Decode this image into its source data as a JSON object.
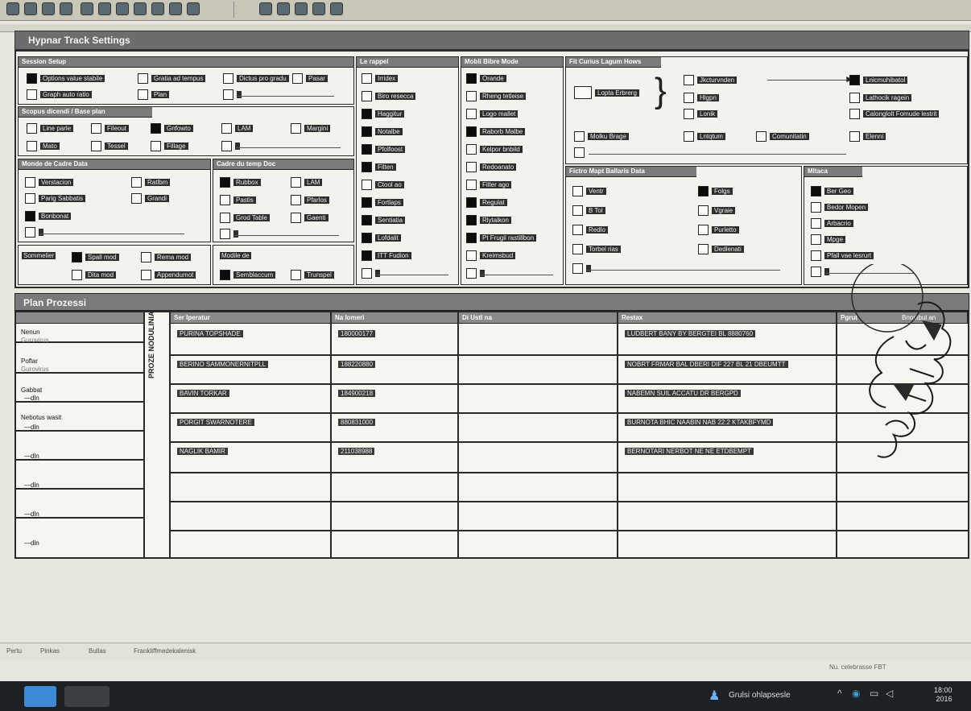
{
  "window": {
    "title": "Hypnar Track Settings"
  },
  "panels": {
    "p1": {
      "head": "Session Setup",
      "options": [
        "Options value stabile",
        "Gratia ad tempus",
        "Dictus pro gradu",
        "Pasar",
        "Graph auto ratio",
        "Plan",
        ""
      ]
    },
    "p2": {
      "head": "Scopus dicendi / Base plan",
      "options": [
        "Line parle",
        "Fileout",
        "Gnfowto",
        "LAM",
        "Margini",
        "Mato",
        "Tessel",
        "Fillage",
        ""
      ]
    },
    "p3": {
      "head": "Monde de Cadre Data",
      "options": [
        "Verstacion",
        "Ratlbm",
        "Parig Sabbatis",
        "Grandi",
        "Bonbonat",
        ""
      ]
    },
    "p4": {
      "head": "Cadre du temp Doc",
      "options": [
        "Rubbox",
        "LAM",
        "Pastis",
        "Pfarlos",
        "Grod Table",
        "Gaenti",
        ""
      ]
    },
    "p5": {
      "head": "Sommelier",
      "left": [
        "Spall mod",
        "Dita mod"
      ],
      "right": [
        "Rema mod",
        "Appendumot"
      ]
    },
    "p6": {
      "head": "Modile de",
      "options": [
        "Semblaccum",
        "Trunspel"
      ]
    },
    "p7": {
      "head": "Le rappel",
      "options": [
        "Irridex",
        "Biro resecca",
        "Haggitur",
        "Notalbe",
        "Pfolfoost",
        "Filten",
        "Ctool ao",
        "Fortlaps",
        "Sentiatia",
        "Lofdalit",
        "ITT Fudion",
        ""
      ]
    },
    "p8": {
      "head": "Mobli Bibre Mode",
      "options": [
        "Orande",
        "Rheng tetleise",
        "Logo mallet",
        "Raborb Malbe",
        "Kelpor bnbild",
        "Redoanato",
        "Filter ago",
        "Regulat",
        "Rlytalkon",
        "Pt Frugil rastillbon",
        "Kreimsbud",
        ""
      ]
    },
    "p9": {
      "head": "Fit Curius Lagum Hows",
      "brace_label": "Lopta Erbrerg",
      "mid": [
        "Jkcturvnden",
        "Hlgpn",
        "Lonik"
      ],
      "right": [
        "Lnicmuhibatol",
        "Lathocik ragein",
        "Calonglolt Fomude lestrit"
      ],
      "row2": [
        "Molku Brage",
        "Lntqtum",
        "Comunitatin",
        "Elenni"
      ]
    },
    "p10": {
      "head": "Fictro Mapt Ballaris Data",
      "left": [
        "Ventr",
        "B Tol",
        "Redlo",
        "Torbel rias",
        ""
      ],
      "right": [
        "Folgs",
        "Vgraie",
        "Purletto",
        "Dedlenati"
      ]
    },
    "p11": {
      "head": "Mltaca",
      "options": [
        "Ber Geo",
        "Bedor Mopen",
        "Arbacrio",
        "Mpge",
        "Pfall vae lesrurt",
        ""
      ]
    }
  },
  "plan": {
    "title": "Plan Prozessi",
    "side_label": "PROZE NODULINIA",
    "columns": [
      "Ser Iperatur",
      "Na lomeri",
      "Di Ustl na",
      "Bnostbul an",
      "Restax",
      "Pgrut"
    ],
    "left_rows": [
      "Nenun",
      "Gurovirus",
      "Poflar",
      "Gurovirus",
      "Gabbat",
      "—dln",
      "Nebotus wasit",
      "—dln",
      "—dln",
      "—dln",
      "—dln",
      "—dln"
    ],
    "rows": [
      {
        "name": "PURINA TOPSHADE",
        "num": "180000177",
        "restax": "LUDBERT BANY BY BERGTEI BL 8880760"
      },
      {
        "name": "BERINO SAMMONERNITPLL",
        "num": "188220880",
        "restax": "NOBRT FRMAR BAL DBERI DIF 227 BL 21 DBEUMTT"
      },
      {
        "name": "BAVIN TORKAR",
        "num": "184900218",
        "restax": "NABEMN SUIL ACCATU DR BERGPD"
      },
      {
        "name": "PORGIT SWARNOTERE",
        "num": "880831000",
        "restax": "BURNOTA BHIC NAABIN NAB 22:2 KTAKBFYMD"
      },
      {
        "name": "NAGLIK BAMIR",
        "num": "211038988",
        "restax": "BERNOTARI NERBOT NE NE ETDBEMPT"
      }
    ]
  },
  "status": {
    "items": [
      "Pertu",
      "Pinkas",
      "Bullas",
      "Frankliffmedekalenisk"
    ],
    "note": "Nu. celebrasse FBT",
    "tray": "Grulsi ohlapsesle",
    "clock_time": "18:00",
    "clock_date": "2016"
  },
  "colors": {
    "header": "#7a7a7a",
    "checked": "#0c0c0c",
    "taskbar": "#1e2124"
  }
}
